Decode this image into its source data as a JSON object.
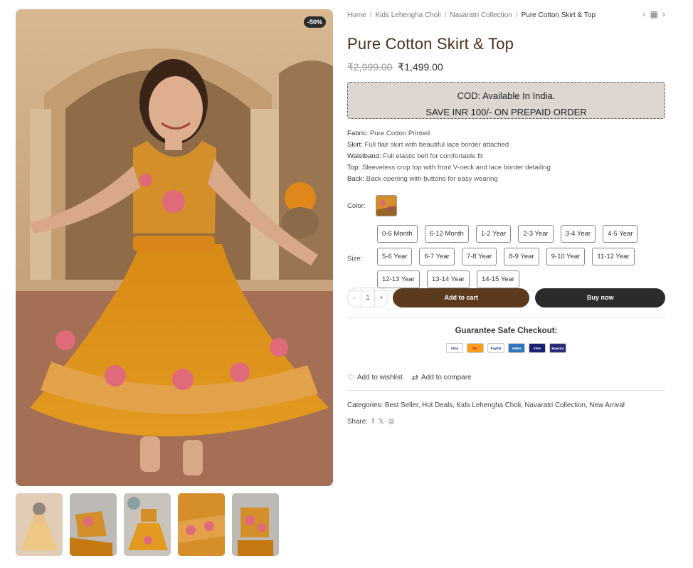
{
  "gallery": {
    "badge": "-50%",
    "thumbnails": [
      "thumb-1",
      "thumb-2",
      "thumb-3",
      "thumb-4",
      "thumb-5"
    ]
  },
  "breadcrumb": {
    "items": [
      "Home",
      "Kids Lehengha Choli",
      "Navaratri Collection"
    ],
    "current": "Pure Cotton Skirt & Top",
    "separator": "/"
  },
  "product": {
    "title": "Pure Cotton Skirt & Top",
    "price_old": "₹2,999.00",
    "price_new": "₹1,499.00",
    "cod_line1": "COD: Available In India.",
    "cod_line2": "SAVE INR 100/- ON PREPAID ORDER",
    "details": [
      {
        "label": "Fabric:",
        "value": "Pure Cotton Printed"
      },
      {
        "label": "Skirt:",
        "value": "Full flair skirt with beautiful lace border attached"
      },
      {
        "label": "Waistband:",
        "value": "Full elastic belt for comfortable fit"
      },
      {
        "label": "Top:",
        "value": "Sleeveless crop top with front V-neck and lace border detailing"
      },
      {
        "label": "Back:",
        "value": "Back opening with buttons for easy wearing"
      }
    ],
    "color_label": "Color:",
    "size_label": "Size:",
    "sizes": [
      [
        "0-6 Month",
        "6-12 Month",
        "1-2 Year",
        "2-3 Year",
        "3-4 Year",
        "4-5 Year"
      ],
      [
        "5-6 Year",
        "6-7 Year",
        "7-8 Year",
        "8-9 Year",
        "9-10 Year",
        "11-12 Year"
      ],
      [
        "12-13 Year",
        "13-14 Year",
        "14-15 Year"
      ]
    ],
    "qty_minus": "-",
    "qty_value": "1",
    "qty_plus": "+",
    "add_to_cart": "Add to cart",
    "buy_now": "Buy now",
    "guarantee": "Guarantee Safe Checkout:",
    "payments": [
      {
        "name": "VISA",
        "bg": "#ffffff",
        "fg": "#1a1f71"
      },
      {
        "name": "MC",
        "bg": "#f79e1b",
        "fg": "#eb001b"
      },
      {
        "name": "PayPal",
        "bg": "#ffffff",
        "fg": "#003087"
      },
      {
        "name": "AMEX",
        "bg": "#2e77bc",
        "fg": "#ffffff"
      },
      {
        "name": "VISA",
        "bg": "#1a1f71",
        "fg": "#ffffff"
      },
      {
        "name": "Maestro",
        "bg": "#2b2b7a",
        "fg": "#ffffff"
      }
    ],
    "wishlist": "Add to wishlist",
    "compare": "Add to compare",
    "categories_label": "Categories:",
    "categories": [
      "Best Seller",
      "Hot Deals",
      "Kids Lehengha Choli",
      "Navaratri Collection",
      "New Arrival"
    ],
    "share_label": "Share:"
  },
  "colors": {
    "accent": "#5b3a1e",
    "dark": "#2b2b2b",
    "title": "#4a2e1a",
    "cod_bg": "#ddd6d1"
  }
}
